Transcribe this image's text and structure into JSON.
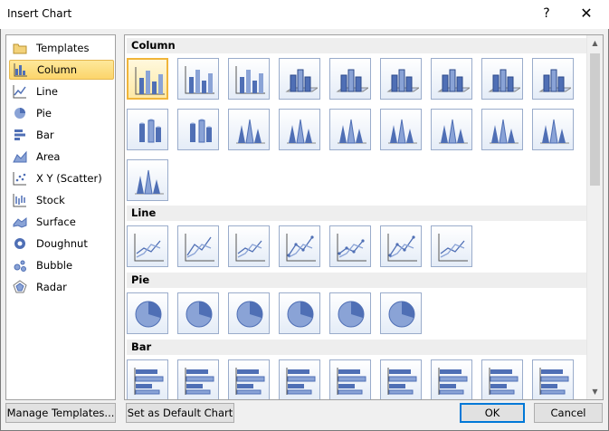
{
  "window": {
    "title": "Insert Chart",
    "help_glyph": "?",
    "close_glyph": "✕"
  },
  "categories": [
    {
      "label": "Templates",
      "icon": "folder-icon"
    },
    {
      "label": "Column",
      "icon": "column-chart-icon",
      "selected": true
    },
    {
      "label": "Line",
      "icon": "line-chart-icon"
    },
    {
      "label": "Pie",
      "icon": "pie-chart-icon"
    },
    {
      "label": "Bar",
      "icon": "bar-chart-icon"
    },
    {
      "label": "Area",
      "icon": "area-chart-icon"
    },
    {
      "label": "X Y (Scatter)",
      "icon": "scatter-chart-icon"
    },
    {
      "label": "Stock",
      "icon": "stock-chart-icon"
    },
    {
      "label": "Surface",
      "icon": "surface-chart-icon"
    },
    {
      "label": "Doughnut",
      "icon": "doughnut-chart-icon"
    },
    {
      "label": "Bubble",
      "icon": "bubble-chart-icon"
    },
    {
      "label": "Radar",
      "icon": "radar-chart-icon"
    }
  ],
  "gallery": {
    "sections": [
      {
        "title": "Column",
        "type": "column",
        "count": 19,
        "selected_index": 0
      },
      {
        "title": "Line",
        "type": "line",
        "count": 7
      },
      {
        "title": "Pie",
        "type": "pie",
        "count": 6
      },
      {
        "title": "Bar",
        "type": "bar",
        "count": 9
      }
    ]
  },
  "buttons": {
    "manage_templates": "Manage Templates...",
    "set_default": "Set as Default Chart",
    "ok": "OK",
    "cancel": "Cancel"
  },
  "colors": {
    "accent_selected": "#fcd56b",
    "chart_blue": "#4f6fb5"
  }
}
